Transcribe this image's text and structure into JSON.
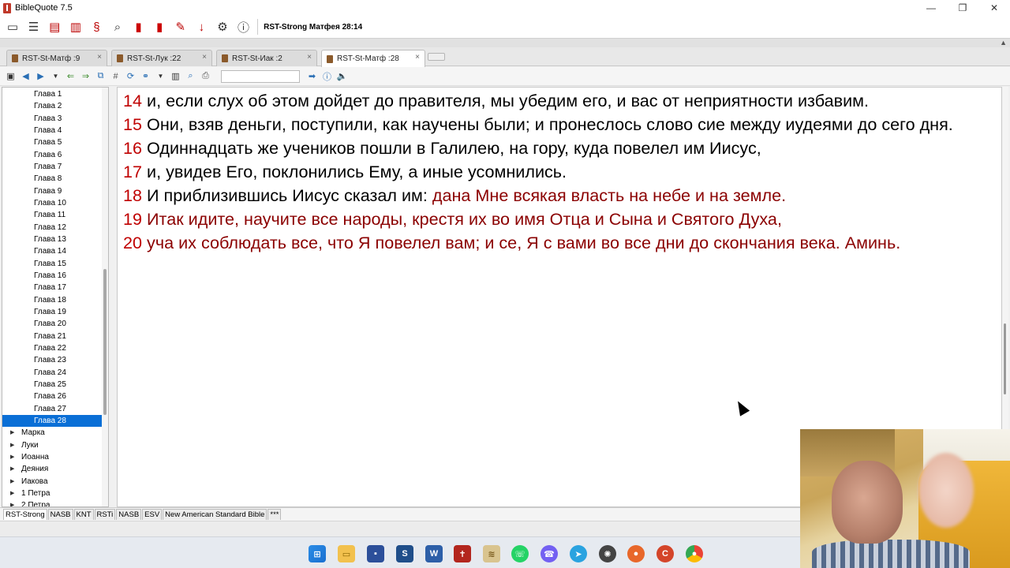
{
  "window": {
    "title": "BibleQuote 7.5",
    "controls": [
      "—",
      "❐",
      "✕"
    ]
  },
  "toolbar": {
    "reference": "RST-Strong Матфея 28:14",
    "icons": [
      "window-icon",
      "layout-icon",
      "list-icon",
      "book-icon",
      "strong-icon",
      "search-icon",
      "bookmark-icon",
      "bookmark-add-icon",
      "notes-icon",
      "download-icon",
      "settings-icon",
      "info-icon"
    ]
  },
  "tabs": [
    {
      "label": "RST-St-Матф :9",
      "active": false
    },
    {
      "label": "RST-St-Лук :22",
      "active": false
    },
    {
      "label": "RST-St-Иак :2",
      "active": false
    },
    {
      "label": "RST-St-Матф :28",
      "active": true
    }
  ],
  "tabClose": "×",
  "navbar": {
    "search_value": ""
  },
  "tree": {
    "chapters": [
      "Глава 1",
      "Глава 2",
      "Глава 3",
      "Глава 4",
      "Глава 5",
      "Глава 6",
      "Глава 7",
      "Глава 8",
      "Глава 9",
      "Глава 10",
      "Глава 11",
      "Глава 12",
      "Глава 13",
      "Глава 14",
      "Глава 15",
      "Глава 16",
      "Глава 17",
      "Глава 18",
      "Глава 19",
      "Глава 20",
      "Глава 21",
      "Глава 22",
      "Глава 23",
      "Глава 24",
      "Глава 25",
      "Глава 26",
      "Глава 27",
      "Глава 28"
    ],
    "selected": "Глава 28",
    "books": [
      "Марка",
      "Луки",
      "Иоанна",
      "Деяния",
      "Иакова",
      "1 Петра",
      "2 Петра"
    ]
  },
  "verses": [
    {
      "num": "14",
      "text": "и, если слух об этом дойдет до правителя, мы убедим его, и вас от неприятности избавим.",
      "red": false
    },
    {
      "num": "15",
      "text": "Они, взяв деньги, поступили, как научены были; и пронеслось слово сие между иудеями до сего дня.",
      "red": false
    },
    {
      "num": "16",
      "text": "Одиннадцать же учеников пошли в Галилею, на гору, куда повелел им Иисус,",
      "red": false
    },
    {
      "num": "17",
      "text": "и, увидев Его, поклонились Ему, а иные усомнились.",
      "red": false
    },
    {
      "num": "18",
      "text": "И приблизившись Иисус сказал им: ",
      "red_text": "дана Мне всякая власть на небе и на земле.",
      "red": false
    },
    {
      "num": "19",
      "text": "Итак идите, научите все народы, крестя их во имя Отца и Сына и Святого Духа,",
      "red": true
    },
    {
      "num": "20",
      "text": "уча их соблюдать все, что Я повелел вам; и се, Я с вами во все дни до скончания века. Аминь.",
      "red": true
    }
  ],
  "modules": [
    "RST-Strong",
    "NASB",
    "KNT",
    "RSTi",
    "NASB",
    "ESV",
    "New American Standard Bible",
    "***"
  ],
  "taskbar": [
    "windows-start-icon",
    "file-explorer-icon",
    "save-icon",
    "sb-app-icon",
    "tw-app-icon",
    "biblequote-icon",
    "scroll-icon",
    "whatsapp-icon",
    "viber-icon",
    "telegram-icon",
    "chatgpt-icon",
    "firefox-icon",
    "ccleaner-icon",
    "chrome-icon"
  ]
}
